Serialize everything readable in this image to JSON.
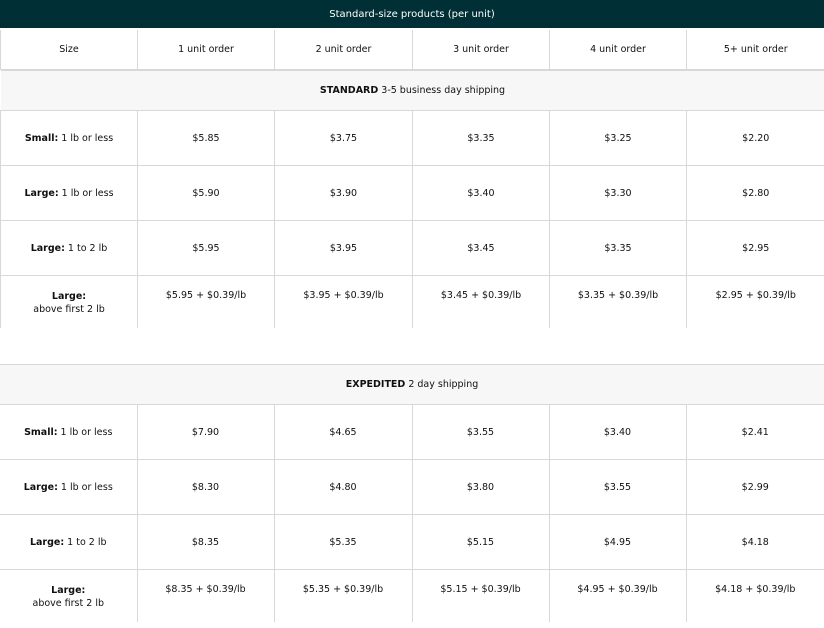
{
  "title": "Standard-size products (per unit)",
  "columns": [
    "Size",
    "1 unit order",
    "2 unit order",
    "3 unit order",
    "4 unit order",
    "5+ unit order"
  ],
  "sections": [
    {
      "name": "STANDARD",
      "detail": " 3-5 business day shipping",
      "rows": [
        {
          "key": "Small:",
          "desc": " 1 lb or less",
          "desc2": "",
          "prices": [
            "$5.85",
            "$3.75",
            "$3.35",
            "$3.25",
            "$2.20"
          ]
        },
        {
          "key": "Large:",
          "desc": " 1 lb or less",
          "desc2": "",
          "prices": [
            "$5.90",
            "$3.90",
            "$3.40",
            "$3.30",
            "$2.80"
          ]
        },
        {
          "key": "Large:",
          "desc": " 1 to 2 lb",
          "desc2": "",
          "prices": [
            "$5.95",
            "$3.95",
            "$3.45",
            "$3.35",
            "$2.95"
          ]
        },
        {
          "key": "Large:",
          "desc": "",
          "desc2": "above first 2 lb",
          "prices": [
            "$5.95 + $0.39/lb",
            "$3.95 + $0.39/lb",
            "$3.45 + $0.39/lb",
            "$3.35 + $0.39/lb",
            "$2.95 + $0.39/lb"
          ]
        }
      ]
    },
    {
      "name": "EXPEDITED",
      "detail": " 2 day shipping",
      "rows": [
        {
          "key": "Small:",
          "desc": " 1 lb or less",
          "desc2": "",
          "prices": [
            "$7.90",
            "$4.65",
            "$3.55",
            "$3.40",
            "$2.41"
          ]
        },
        {
          "key": "Large:",
          "desc": " 1 lb or less",
          "desc2": "",
          "prices": [
            "$8.30",
            "$4.80",
            "$3.80",
            "$3.55",
            "$2.99"
          ]
        },
        {
          "key": "Large:",
          "desc": " 1 to 2 lb",
          "desc2": "",
          "prices": [
            "$8.35",
            "$5.35",
            "$5.15",
            "$4.95",
            "$4.18"
          ]
        },
        {
          "key": "Large:",
          "desc": "",
          "desc2": "above first 2 lb",
          "prices": [
            "$8.35 + $0.39/lb",
            "$5.35 + $0.39/lb",
            "$5.15 + $0.39/lb",
            "$4.95 + $0.39/lb",
            "$4.18 + $0.39/lb"
          ]
        }
      ]
    }
  ],
  "colors": {
    "title_bg": "#002f36",
    "section_bg": "#f7f7f7",
    "border": "#d5d9d9"
  }
}
